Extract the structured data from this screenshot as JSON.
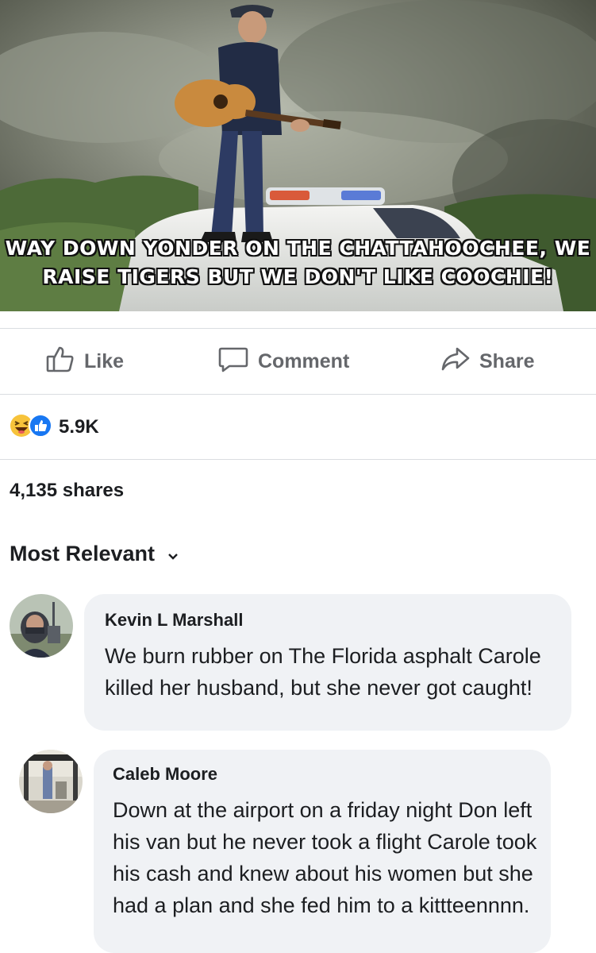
{
  "post": {
    "meme_caption_line1": "WAY DOWN YONDER ON THE CHATTAHOOCHEE, WE",
    "meme_caption_line2": "RAISE TIGERS BUT WE DON'T LIKE COOCHIE!"
  },
  "actions": {
    "like_label": "Like",
    "comment_label": "Comment",
    "share_label": "Share"
  },
  "reactions": {
    "count": "5.9K",
    "icons": [
      "haha-icon",
      "like-icon"
    ]
  },
  "shares": "4,135 shares",
  "sort": {
    "label": "Most Relevant"
  },
  "comments": [
    {
      "author": "Kevin L Marshall",
      "text": "We burn rubber on The Florida asphalt Carole killed her husband, but she never got caught!"
    },
    {
      "author": "Caleb Moore",
      "text": "Down at the airport on a friday night Don left his van but he never took a flight Carole took his cash and knew about his women but she had a plan and she fed him to a kittteennnn."
    }
  ]
}
